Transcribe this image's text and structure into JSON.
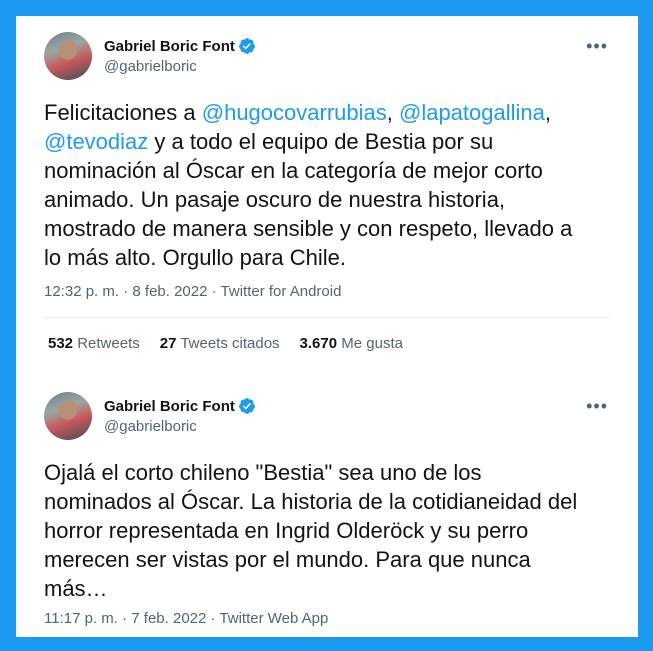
{
  "tweet1": {
    "author": {
      "name": "Gabriel Boric Font",
      "handle": "@gabrielboric"
    },
    "text_parts": {
      "p1": "Felicitaciones a ",
      "m1": "@hugocovarrubias",
      "p2": ", ",
      "m2": "@lapatogallina",
      "p3": ",\n",
      "m3": "@tevodiaz",
      "p4": " y a todo el equipo de Bestia por su\nnominación al Óscar en la categoría de mejor corto\nanimado. Un pasaje oscuro de nuestra historia,\nmostrado de manera sensible y con respeto, llevado a\nlo más alto. Orgullo para Chile."
    },
    "time": "12:32 p. m.",
    "date": "8 feb. 2022",
    "source": "Twitter for Android",
    "stats": {
      "retweets_count": "532",
      "retweets_label": "Retweets",
      "quotes_count": "27",
      "quotes_label": "Tweets citados",
      "likes_count": "3.670",
      "likes_label": "Me gusta"
    }
  },
  "tweet2": {
    "author": {
      "name": "Gabriel Boric Font",
      "handle": "@gabrielboric"
    },
    "text": "Ojalá el corto chileno \"Bestia\" sea uno de los\nnominados al Óscar. La historia de la cotidianeidad del\nhorror representada en Ingrid Olderöck y su perro\nmerecen ser vistas por el mundo. Para que nunca\nmás…",
    "time": "11:17 p. m.",
    "date": "7 feb. 2022",
    "source": "Twitter Web App"
  },
  "separator": " · ",
  "colors": {
    "frame": "#1d9bf0",
    "link": "#1d9bf0",
    "secondary_text": "#536471",
    "verified": "#1d9bf0"
  },
  "icons": {
    "more": "more-horizontal-icon",
    "verified": "verified-badge-icon"
  }
}
